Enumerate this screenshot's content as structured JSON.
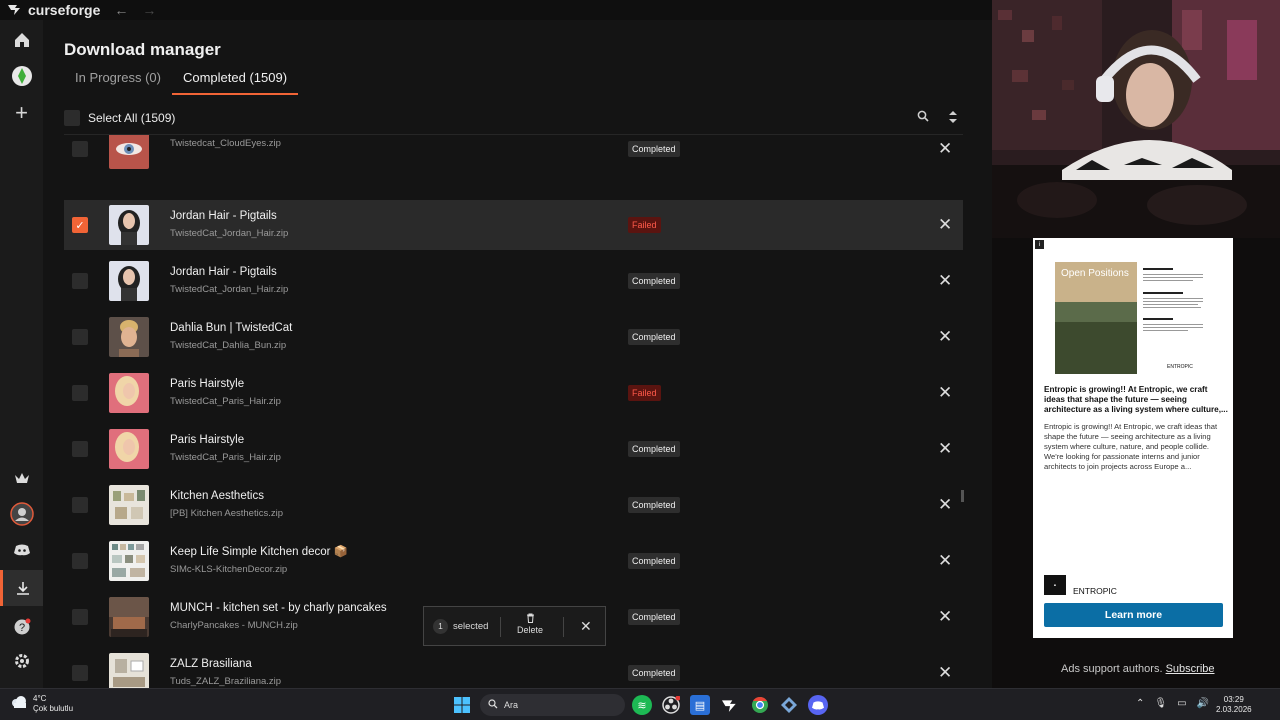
{
  "app": {
    "name": "curseforge",
    "back_icon": "back-arrow-icon",
    "forward_icon": "forward-arrow-icon"
  },
  "sidebar": {
    "items": [
      {
        "name": "home",
        "icon": "home-icon"
      },
      {
        "name": "sims",
        "icon": "sims-plumbob-icon"
      },
      {
        "name": "add",
        "icon": "plus-icon"
      },
      {
        "name": "premium",
        "icon": "crown-icon"
      },
      {
        "name": "profile",
        "icon": "avatar-icon"
      },
      {
        "name": "discord",
        "icon": "discord-icon"
      },
      {
        "name": "downloads",
        "icon": "download-icon",
        "active": true
      },
      {
        "name": "help",
        "icon": "help-icon"
      },
      {
        "name": "settings",
        "icon": "gear-icon"
      }
    ]
  },
  "page": {
    "title": "Download manager",
    "tabs": [
      {
        "label": "In Progress (0)",
        "active": false
      },
      {
        "label": "Completed (1509)",
        "active": true
      }
    ],
    "select_all": "Select All (1509)"
  },
  "rows": [
    {
      "title": "",
      "file": "Twistedcat_CloudEyes.zip",
      "status": "Completed",
      "checked": false
    },
    {
      "title": "Jordan Hair - Pigtails",
      "file": "TwistedCat_Jordan_Hair.zip",
      "status": "Failed",
      "checked": true
    },
    {
      "title": "Jordan Hair - Pigtails",
      "file": "TwistedCat_Jordan_Hair.zip",
      "status": "Completed",
      "checked": false
    },
    {
      "title": "Dahlia Bun | TwistedCat",
      "file": "TwistedCat_Dahlia_Bun.zip",
      "status": "Completed",
      "checked": false
    },
    {
      "title": "Paris Hairstyle",
      "file": "TwistedCat_Paris_Hair.zip",
      "status": "Failed",
      "checked": false
    },
    {
      "title": "Paris Hairstyle",
      "file": "TwistedCat_Paris_Hair.zip",
      "status": "Completed",
      "checked": false
    },
    {
      "title": "Kitchen Aesthetics",
      "file": "[PB] Kitchen Aesthetics.zip",
      "status": "Completed",
      "checked": false
    },
    {
      "title": "Keep Life Simple Kitchen decor 📦",
      "file": "SIMc-KLS-KitchenDecor.zip",
      "status": "Completed",
      "checked": false
    },
    {
      "title": "MUNCH - kitchen set - by charly pancakes",
      "file": "CharlyPancakes - MUNCH.zip",
      "status": "Completed",
      "checked": false
    },
    {
      "title": "ZALZ Brasiliana",
      "file": "Tuds_ZALZ_Braziliana.zip",
      "status": "Completed",
      "checked": false
    }
  ],
  "selection_toast": {
    "count": "1",
    "selected_label": "selected",
    "delete_label": "Delete"
  },
  "ad": {
    "poster_title": "Open Positions",
    "poster_brand": "ENTROPIC",
    "headline": "Entropic is growing!! At Entropic, we craft ideas that shape the future — seeing architecture as a living system where culture,...",
    "body": "Entropic is growing!! At Entropic, we craft ideas that shape the future — seeing architecture as a living system where culture, nature, and people collide. We're looking for passionate interns and junior architects to join projects across Europe a...",
    "brand": "ENTROPIC",
    "cta": "Learn more",
    "note": "Ads support authors.",
    "subscribe": "Subscribe"
  },
  "taskbar": {
    "temp": "4°C",
    "weather": "Çok bulutlu",
    "search_placeholder": "Ara",
    "time": "03:29",
    "date": "2.03.2026"
  }
}
